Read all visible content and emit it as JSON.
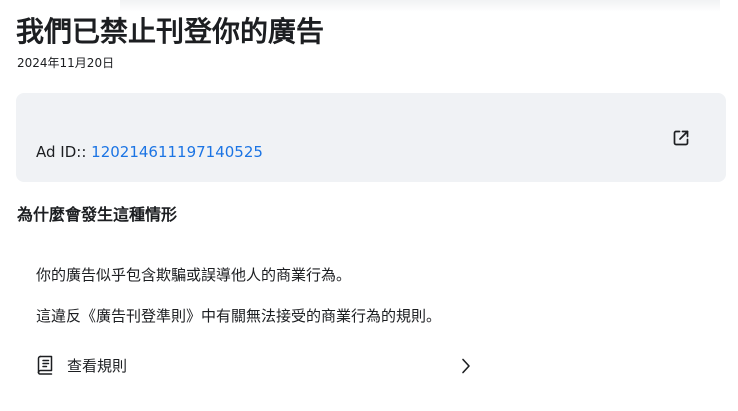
{
  "page": {
    "title": "我們已禁止刊登你的廣告",
    "date": "2024年11月20日"
  },
  "ad_card": {
    "id_label": "Ad ID::",
    "id_value": "120214611197140525",
    "external_link_icon": "external-link-icon"
  },
  "reason": {
    "heading": "為什麼會發生這種情形",
    "lines": [
      "你的廣告似乎包含欺騙或誤導他人的商業行為。",
      "這違反《廣告刊登準則》中有關無法接受的商業行為的規則。"
    ]
  },
  "rules_link": {
    "icon": "book-icon",
    "label": "查看規則",
    "chevron": "chevron-right-icon"
  },
  "colors": {
    "text": "#1c1e21",
    "link": "#1b74e4",
    "card_background": "#f0f2f5"
  }
}
